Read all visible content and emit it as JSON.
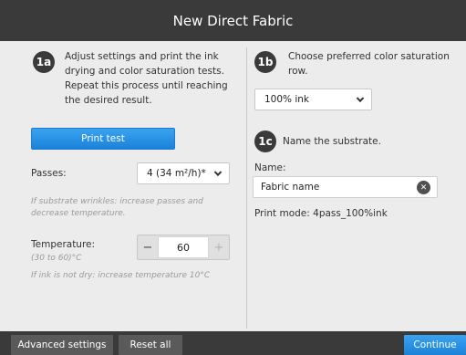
{
  "window": {
    "title": "New Direct Fabric"
  },
  "step1a": {
    "badge": "1a",
    "text": "Adjust settings and print the ink drying and color saturation tests. Repeat this process until reaching the desired result.",
    "print_button": "Print test",
    "passes_label": "Passes:",
    "passes_value": "4  (34 m²/h)*",
    "passes_hint": "If substrate wrinkles: increase passes and decrease temperature.",
    "temperature_label": "Temperature:",
    "temperature_range": "(30 to 60)°C",
    "temperature_value": "60",
    "temperature_hint": "If ink is not dry: increase temperature 10°C",
    "minus": "−",
    "plus": "+"
  },
  "step1b": {
    "badge": "1b",
    "text": "Choose preferred color saturation row.",
    "saturation_value": "100% ink"
  },
  "step1c": {
    "badge": "1c",
    "text": "Name the substrate.",
    "name_label": "Name:",
    "name_value": "Fabric name",
    "clear_glyph": "✕",
    "print_mode": "Print mode: 4pass_100%ink"
  },
  "footer": {
    "advanced": "Advanced settings",
    "reset": "Reset all",
    "continue": "Continue"
  },
  "colors": {
    "accent": "#1b82d9",
    "bar": "#3a3a3a"
  }
}
